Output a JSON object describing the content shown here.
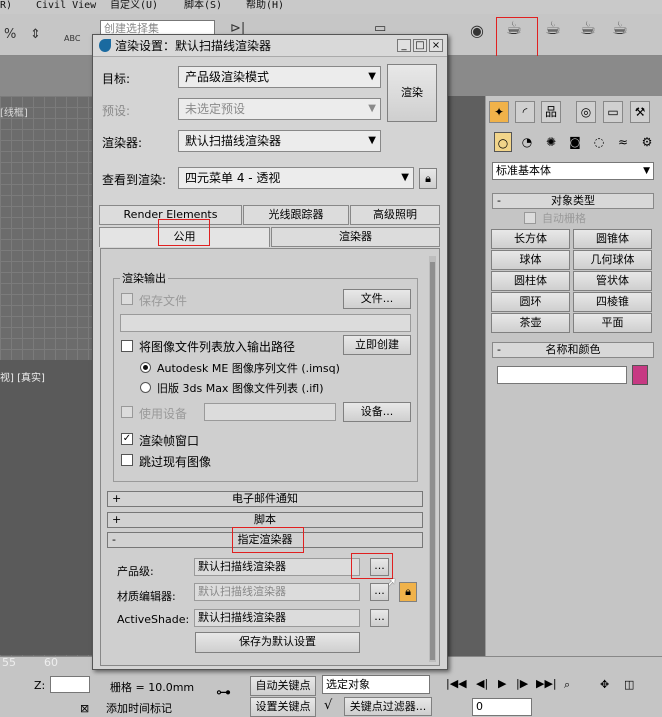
{
  "menubar": {
    "items": [
      "R)",
      "Civil View",
      "自定义(U)",
      "脚本(S)",
      "帮助(H)"
    ]
  },
  "toolbar": {
    "selection_set_placeholder": "创建选择集",
    "icons": [
      "snap-percent-icon",
      "spinner-snap-icon",
      "abc-icon",
      "render-setup-icon",
      "rendered-frame-icon",
      "render-icon"
    ]
  },
  "viewports": {
    "top_label": "[线框]",
    "persp_label": "视] [真实]"
  },
  "dialog": {
    "title": "渲染设置：默认扫描线渲染器",
    "window_buttons": [
      "_",
      "□",
      "×"
    ],
    "target_label": "目标:",
    "target_value": "产品级渲染模式",
    "preset_label": "预设:",
    "preset_value": "未选定预设",
    "renderer_label": "渲染器:",
    "renderer_value": "默认扫描线渲染器",
    "view_label": "查看到渲染:",
    "view_value": "四元菜单 4 - 透视",
    "render_button": "渲染",
    "tabs": [
      "Render Elements",
      "光线跟踪器",
      "高级照明",
      "公用",
      "渲染器"
    ],
    "render_output": {
      "group_label": "渲染输出",
      "save_file": "保存文件",
      "files_button": "文件...",
      "put_image_list": "将图像文件列表放入输出路径",
      "create_now_button": "立即创建",
      "option_autodesk": "Autodesk ME 图像序列文件 (.imsq)",
      "option_legacy": "旧版 3ds Max 图像文件列表 (.ifl)",
      "use_device": "使用设备",
      "devices_button": "设备...",
      "rendered_frame_window": "渲染帧窗口",
      "skip_existing": "跳过现有图像"
    },
    "rollouts": [
      {
        "sign": "+",
        "title": "电子邮件通知"
      },
      {
        "sign": "+",
        "title": "脚本"
      },
      {
        "sign": "-",
        "title": "指定渲染器"
      }
    ],
    "assign": {
      "production_label": "产品级:",
      "production_value": "默认扫描线渲染器",
      "material_editor_label": "材质编辑器:",
      "material_editor_value": "默认扫描线渲染器",
      "activeshade_label": "ActiveShade:",
      "activeshade_value": "默认扫描线渲染器",
      "browse": "...",
      "save_default_button": "保存为默认设置"
    }
  },
  "command_panel": {
    "category_value": "标准基本体",
    "object_type_title": "对象类型",
    "autogrid": "自动栅格",
    "objects": [
      "长方体",
      "圆锥体",
      "球体",
      "几何球体",
      "圆柱体",
      "管状体",
      "圆环",
      "四棱锥",
      "茶壶",
      "平面"
    ],
    "name_color_title": "名称和颜色",
    "swatch_color": "#c73a83"
  },
  "status": {
    "ruler_ticks": [
      "55",
      "60"
    ],
    "z_label": "Z:",
    "grid": "栅格 = 10.0mm",
    "auto_key": "自动关键点",
    "set_key": "设置关键点",
    "selected_object": "选定对象",
    "key_filters": "关键点过滤器...",
    "frame": "0",
    "add_time_tag": "添加时间标记"
  },
  "colors": {
    "highlight": "#e02020",
    "accent": "#f0b24a"
  }
}
